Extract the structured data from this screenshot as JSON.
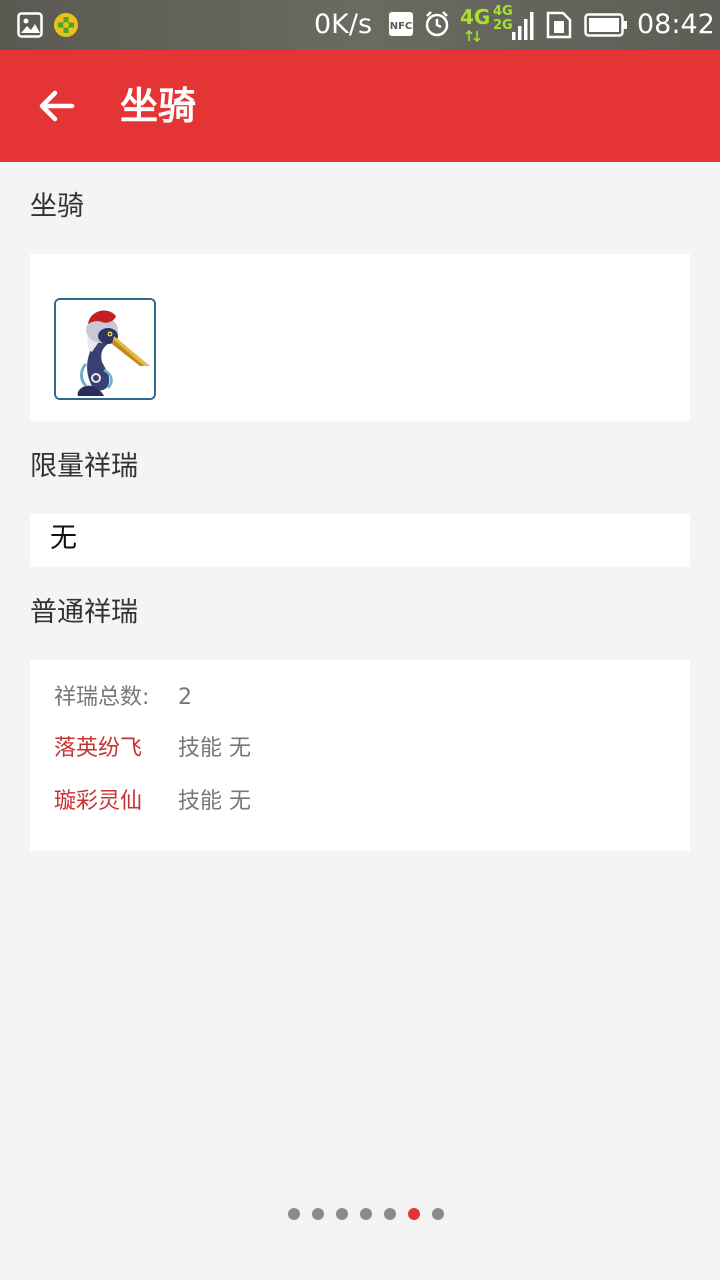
{
  "status_bar": {
    "network_speed": "0K/s",
    "network_type": "4G",
    "signal_label": "4G\n2G",
    "time": "08:42",
    "icons": [
      "gallery-icon",
      "game-icon",
      "nfc-icon",
      "alarm-icon",
      "signal-icon",
      "sim-icon",
      "battery-icon"
    ]
  },
  "app_bar": {
    "title": "坐骑",
    "back_icon": "arrow-left-icon",
    "background": "#e53434"
  },
  "sections": {
    "mount_label": "坐骑",
    "mount_thumb": "crane-mount-image",
    "limited_label": "限量祥瑞",
    "limited_value": "无",
    "common_label": "普通祥瑞",
    "common_total_label": "祥瑞总数:",
    "common_total_value": "2",
    "common_items": [
      {
        "name": "落英纷飞",
        "skill": "技能 无"
      },
      {
        "name": "璇彩灵仙",
        "skill": "技能 无"
      }
    ]
  },
  "pagination": {
    "count": 7,
    "active_index": 5,
    "active_color": "#e53434",
    "inactive_color": "#8a8a8a"
  }
}
